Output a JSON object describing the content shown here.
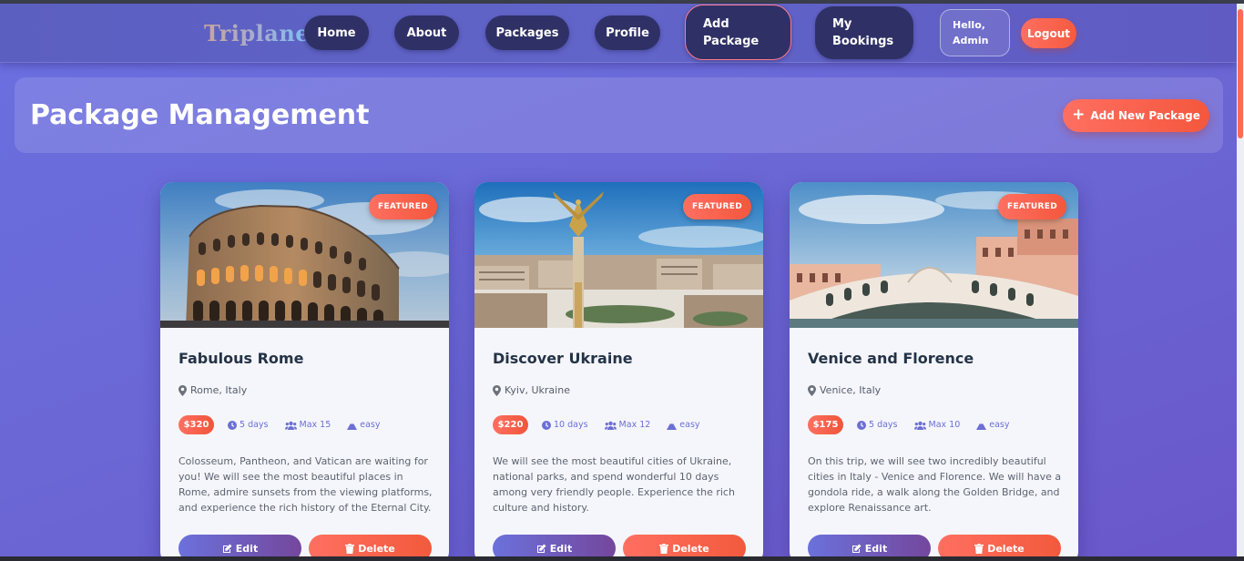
{
  "nav": {
    "logo": "Triplane",
    "items": [
      {
        "label": "Home"
      },
      {
        "label": "About"
      },
      {
        "label": "Packages"
      },
      {
        "label": "Profile"
      },
      {
        "label": "Add Package",
        "active": true
      },
      {
        "label": "My Bookings"
      }
    ],
    "greeting": "Hello, Admin",
    "logout": "Logout"
  },
  "header": {
    "title": "Package Management",
    "add_button": "Add New Package",
    "add_icon": "plus-icon"
  },
  "colors": {
    "accent": "#ff6f61",
    "nav_button": "#2f3166",
    "meta_text": "#6c6fd4",
    "title_text": "#243347"
  },
  "packages": [
    {
      "badge": "FEATURED",
      "title": "Fabulous Rome",
      "location": "Rome, Italy",
      "price": "$320",
      "duration": "5 days",
      "capacity": "Max 15",
      "difficulty": "easy",
      "description": "Colosseum, Pantheon, and Vatican are waiting for you! We will see the most beautiful places in Rome, admire sunsets from the viewing platforms, and experience the rich history of the Eternal City.",
      "edit": "Edit",
      "delete": "Delete"
    },
    {
      "badge": "FEATURED",
      "title": "Discover Ukraine",
      "location": "Kyiv, Ukraine",
      "price": "$220",
      "duration": "10 days",
      "capacity": "Max 12",
      "difficulty": "easy",
      "description": "We will see the most beautiful cities of Ukraine, national parks, and spend wonderful 10 days among very friendly people. Experience the rich culture and history.",
      "edit": "Edit",
      "delete": "Delete"
    },
    {
      "badge": "FEATURED",
      "title": "Venice and Florence",
      "location": "Venice, Italy",
      "price": "$175",
      "duration": "5 days",
      "capacity": "Max 10",
      "difficulty": "easy",
      "description": "On this trip, we will see two incredibly beautiful cities in Italy - Venice and Florence. We will have a gondola ride, a walk along the Golden Bridge, and explore Renaissance art.",
      "edit": "Edit",
      "delete": "Delete"
    }
  ]
}
